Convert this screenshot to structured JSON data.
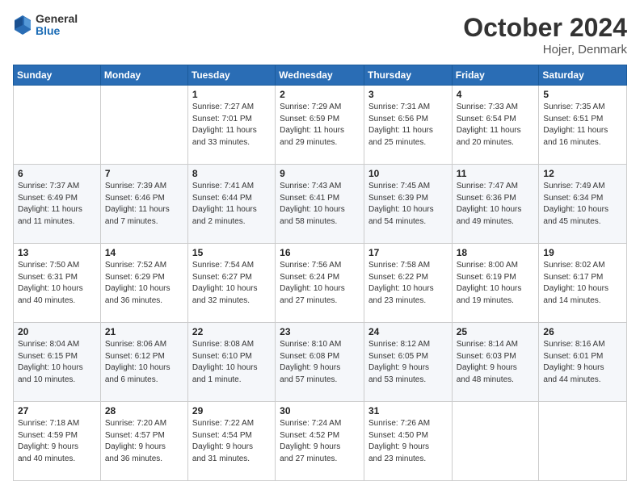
{
  "header": {
    "logo_general": "General",
    "logo_blue": "Blue",
    "month_title": "October 2024",
    "location": "Hojer, Denmark"
  },
  "days_of_week": [
    "Sunday",
    "Monday",
    "Tuesday",
    "Wednesday",
    "Thursday",
    "Friday",
    "Saturday"
  ],
  "weeks": [
    [
      {
        "day": "",
        "info": ""
      },
      {
        "day": "",
        "info": ""
      },
      {
        "day": "1",
        "info": "Sunrise: 7:27 AM\nSunset: 7:01 PM\nDaylight: 11 hours\nand 33 minutes."
      },
      {
        "day": "2",
        "info": "Sunrise: 7:29 AM\nSunset: 6:59 PM\nDaylight: 11 hours\nand 29 minutes."
      },
      {
        "day": "3",
        "info": "Sunrise: 7:31 AM\nSunset: 6:56 PM\nDaylight: 11 hours\nand 25 minutes."
      },
      {
        "day": "4",
        "info": "Sunrise: 7:33 AM\nSunset: 6:54 PM\nDaylight: 11 hours\nand 20 minutes."
      },
      {
        "day": "5",
        "info": "Sunrise: 7:35 AM\nSunset: 6:51 PM\nDaylight: 11 hours\nand 16 minutes."
      }
    ],
    [
      {
        "day": "6",
        "info": "Sunrise: 7:37 AM\nSunset: 6:49 PM\nDaylight: 11 hours\nand 11 minutes."
      },
      {
        "day": "7",
        "info": "Sunrise: 7:39 AM\nSunset: 6:46 PM\nDaylight: 11 hours\nand 7 minutes."
      },
      {
        "day": "8",
        "info": "Sunrise: 7:41 AM\nSunset: 6:44 PM\nDaylight: 11 hours\nand 2 minutes."
      },
      {
        "day": "9",
        "info": "Sunrise: 7:43 AM\nSunset: 6:41 PM\nDaylight: 10 hours\nand 58 minutes."
      },
      {
        "day": "10",
        "info": "Sunrise: 7:45 AM\nSunset: 6:39 PM\nDaylight: 10 hours\nand 54 minutes."
      },
      {
        "day": "11",
        "info": "Sunrise: 7:47 AM\nSunset: 6:36 PM\nDaylight: 10 hours\nand 49 minutes."
      },
      {
        "day": "12",
        "info": "Sunrise: 7:49 AM\nSunset: 6:34 PM\nDaylight: 10 hours\nand 45 minutes."
      }
    ],
    [
      {
        "day": "13",
        "info": "Sunrise: 7:50 AM\nSunset: 6:31 PM\nDaylight: 10 hours\nand 40 minutes."
      },
      {
        "day": "14",
        "info": "Sunrise: 7:52 AM\nSunset: 6:29 PM\nDaylight: 10 hours\nand 36 minutes."
      },
      {
        "day": "15",
        "info": "Sunrise: 7:54 AM\nSunset: 6:27 PM\nDaylight: 10 hours\nand 32 minutes."
      },
      {
        "day": "16",
        "info": "Sunrise: 7:56 AM\nSunset: 6:24 PM\nDaylight: 10 hours\nand 27 minutes."
      },
      {
        "day": "17",
        "info": "Sunrise: 7:58 AM\nSunset: 6:22 PM\nDaylight: 10 hours\nand 23 minutes."
      },
      {
        "day": "18",
        "info": "Sunrise: 8:00 AM\nSunset: 6:19 PM\nDaylight: 10 hours\nand 19 minutes."
      },
      {
        "day": "19",
        "info": "Sunrise: 8:02 AM\nSunset: 6:17 PM\nDaylight: 10 hours\nand 14 minutes."
      }
    ],
    [
      {
        "day": "20",
        "info": "Sunrise: 8:04 AM\nSunset: 6:15 PM\nDaylight: 10 hours\nand 10 minutes."
      },
      {
        "day": "21",
        "info": "Sunrise: 8:06 AM\nSunset: 6:12 PM\nDaylight: 10 hours\nand 6 minutes."
      },
      {
        "day": "22",
        "info": "Sunrise: 8:08 AM\nSunset: 6:10 PM\nDaylight: 10 hours\nand 1 minute."
      },
      {
        "day": "23",
        "info": "Sunrise: 8:10 AM\nSunset: 6:08 PM\nDaylight: 9 hours\nand 57 minutes."
      },
      {
        "day": "24",
        "info": "Sunrise: 8:12 AM\nSunset: 6:05 PM\nDaylight: 9 hours\nand 53 minutes."
      },
      {
        "day": "25",
        "info": "Sunrise: 8:14 AM\nSunset: 6:03 PM\nDaylight: 9 hours\nand 48 minutes."
      },
      {
        "day": "26",
        "info": "Sunrise: 8:16 AM\nSunset: 6:01 PM\nDaylight: 9 hours\nand 44 minutes."
      }
    ],
    [
      {
        "day": "27",
        "info": "Sunrise: 7:18 AM\nSunset: 4:59 PM\nDaylight: 9 hours\nand 40 minutes."
      },
      {
        "day": "28",
        "info": "Sunrise: 7:20 AM\nSunset: 4:57 PM\nDaylight: 9 hours\nand 36 minutes."
      },
      {
        "day": "29",
        "info": "Sunrise: 7:22 AM\nSunset: 4:54 PM\nDaylight: 9 hours\nand 31 minutes."
      },
      {
        "day": "30",
        "info": "Sunrise: 7:24 AM\nSunset: 4:52 PM\nDaylight: 9 hours\nand 27 minutes."
      },
      {
        "day": "31",
        "info": "Sunrise: 7:26 AM\nSunset: 4:50 PM\nDaylight: 9 hours\nand 23 minutes."
      },
      {
        "day": "",
        "info": ""
      },
      {
        "day": "",
        "info": ""
      }
    ]
  ]
}
